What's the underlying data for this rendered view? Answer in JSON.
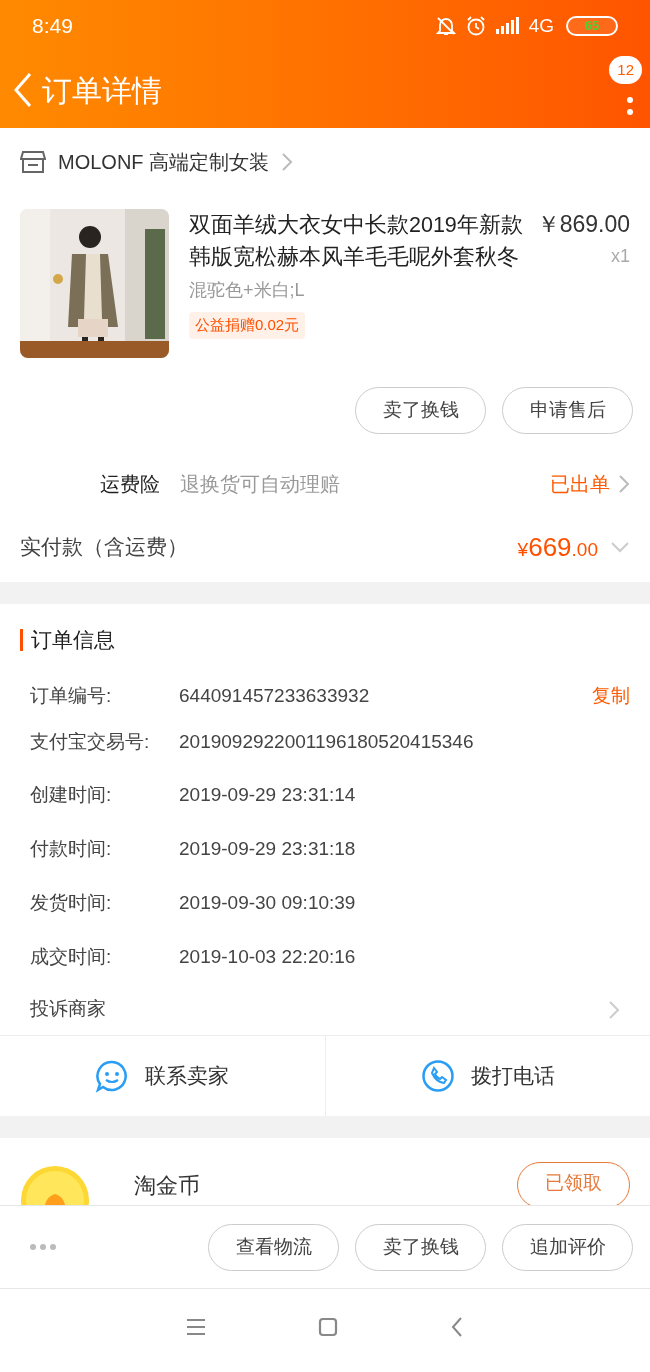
{
  "status_bar": {
    "time": "8:49",
    "network": "4G",
    "battery": "65"
  },
  "header": {
    "title": "订单详情",
    "badge": "12"
  },
  "shop": {
    "name": "MOLONF 高端定制女装"
  },
  "product": {
    "title": "双面羊绒大衣女中长款2019年新款韩版宽松赫本风羊毛毛呢外套秋冬",
    "price": "￥869.00",
    "quantity": "x1",
    "variant": "混驼色+米白;L",
    "donation": "公益捐赠0.02元"
  },
  "product_actions": [
    "卖了换钱",
    "申请售后"
  ],
  "insurance": {
    "label": "运费险",
    "description": "退换货可自动理赔",
    "status": "已出单"
  },
  "payment": {
    "label": "实付款（含运费）",
    "currency": "¥",
    "amount": "669",
    "cents": ".00"
  },
  "order_info": {
    "title": "订单信息",
    "rows": [
      {
        "label": "订单编号:",
        "value": "644091457233633932",
        "action": "复制"
      },
      {
        "label": "支付宝交易号:",
        "value": "2019092922001196180520415346"
      },
      {
        "label": "创建时间:",
        "value": "2019-09-29 23:31:14"
      },
      {
        "label": "付款时间:",
        "value": "2019-09-29 23:31:18"
      },
      {
        "label": "发货时间:",
        "value": "2019-09-30 09:10:39"
      },
      {
        "label": "成交时间:",
        "value": "2019-10-03 22:20:16"
      }
    ],
    "complaint": "投诉商家"
  },
  "contact": [
    {
      "kind": "chat",
      "label": "联系卖家"
    },
    {
      "kind": "phone",
      "label": "拨打电话"
    }
  ],
  "coins": {
    "title": "淘金币",
    "button": "已领取"
  },
  "bottom_actions": [
    "查看物流",
    "卖了换钱",
    "追加评价"
  ]
}
